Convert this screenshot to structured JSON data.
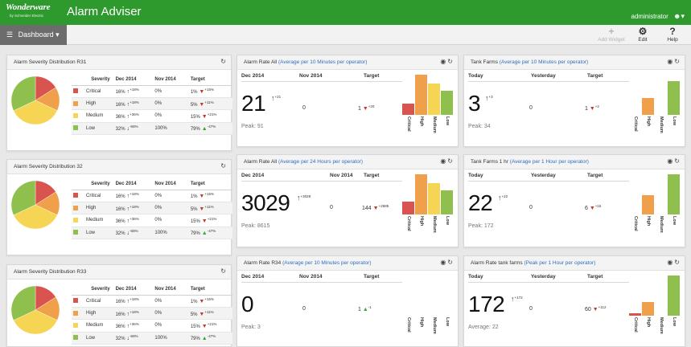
{
  "header": {
    "logo_text": "Wonderware",
    "logo_sub": "by Schneider Electric",
    "title": "Alarm Adviser",
    "user": "administrator"
  },
  "toolbar": {
    "dashboard_label": "Dashboard",
    "add_widget_label": "Add Widget",
    "edit_label": "Edit",
    "help_label": "Help"
  },
  "colors": {
    "critical": "#d9534f",
    "high": "#f0a04b",
    "medium": "#f7d554",
    "low": "#8fbf4d",
    "brand_green": "#2e9a2e"
  },
  "severity_panels": [
    {
      "title": "Alarm Severity Distribution R31",
      "headers": [
        "Severity",
        "Dec 2014",
        "Nov 2014",
        "Target"
      ],
      "rows": [
        {
          "sev": "Critical",
          "dec": "16%",
          "dec_delta": "+18%",
          "nov": "0%",
          "target": "1%",
          "target_delta": "+15%"
        },
        {
          "sev": "High",
          "dec": "16%",
          "dec_delta": "+18%",
          "nov": "0%",
          "target": "5%",
          "target_delta": "+11%"
        },
        {
          "sev": "Medium",
          "dec": "36%",
          "dec_delta": "+36%",
          "nov": "0%",
          "target": "15%",
          "target_delta": "+21%"
        },
        {
          "sev": "Low",
          "dec": "32%",
          "dec_delta": "-68%",
          "nov": "100%",
          "target": "79%",
          "target_delta": "-47%"
        }
      ]
    },
    {
      "title": "Alarm Severity Distribution 32",
      "headers": [
        "Severity",
        "Dec 2014",
        "Nov 2014",
        "Target"
      ],
      "rows": [
        {
          "sev": "Critical",
          "dec": "16%",
          "dec_delta": "+18%",
          "nov": "0%",
          "target": "1%",
          "target_delta": "+15%"
        },
        {
          "sev": "High",
          "dec": "16%",
          "dec_delta": "+18%",
          "nov": "0%",
          "target": "5%",
          "target_delta": "+11%"
        },
        {
          "sev": "Medium",
          "dec": "36%",
          "dec_delta": "+36%",
          "nov": "0%",
          "target": "15%",
          "target_delta": "+21%"
        },
        {
          "sev": "Low",
          "dec": "32%",
          "dec_delta": "-68%",
          "nov": "100%",
          "target": "79%",
          "target_delta": "-47%"
        }
      ]
    },
    {
      "title": "Alarm Severity Distribution R33",
      "headers": [
        "Severity",
        "Dec 2014",
        "Nov 2014",
        "Target"
      ],
      "rows": [
        {
          "sev": "Critical",
          "dec": "16%",
          "dec_delta": "+18%",
          "nov": "0%",
          "target": "1%",
          "target_delta": "+15%"
        },
        {
          "sev": "High",
          "dec": "16%",
          "dec_delta": "+18%",
          "nov": "0%",
          "target": "5%",
          "target_delta": "+11%"
        },
        {
          "sev": "Medium",
          "dec": "36%",
          "dec_delta": "+36%",
          "nov": "0%",
          "target": "15%",
          "target_delta": "+21%"
        },
        {
          "sev": "Low",
          "dec": "32%",
          "dec_delta": "-68%",
          "nov": "100%",
          "target": "79%",
          "target_delta": "-47%"
        }
      ]
    }
  ],
  "pie_shares": [
    {
      "sev": "Critical",
      "pct": 16
    },
    {
      "sev": "High",
      "pct": 16
    },
    {
      "sev": "Medium",
      "pct": 36
    },
    {
      "sev": "Low",
      "pct": 32
    }
  ],
  "rate_panels": [
    {
      "title": "Alarm Rate All",
      "subtitle": "(Average per 10 Minutes per operator)",
      "col1": "Dec 2014",
      "col2": "Nov 2014",
      "col3": "Target",
      "big": "21",
      "big_delta": "+21",
      "big_trend": "up",
      "mid": "0",
      "target": "1",
      "target_delta": "+20",
      "target_trend": "down",
      "peak": "Peak: 91",
      "bars": [
        {
          "sev": "Critical",
          "level": 0.27
        },
        {
          "sev": "High",
          "level": 1.0
        },
        {
          "sev": "Medium",
          "level": 0.77
        },
        {
          "sev": "Low",
          "level": 0.6
        }
      ]
    },
    {
      "title": "Tank Farms",
      "subtitle": "(Average per 10 Minutes per operator)",
      "col1": "Today",
      "col2": "Yesterday",
      "col3": "Target",
      "big": "3",
      "big_delta": "+3",
      "big_trend": "up",
      "mid": "0",
      "target": "1",
      "target_delta": "+2",
      "target_trend": "down",
      "peak": "Peak: 34",
      "bars": [
        {
          "sev": "Critical",
          "level": 0
        },
        {
          "sev": "High",
          "level": 0.42
        },
        {
          "sev": "Medium",
          "level": 0
        },
        {
          "sev": "Low",
          "level": 0.83
        }
      ]
    },
    {
      "title": "Alarm Rate All",
      "subtitle": "(Average per 24 Hours per operator)",
      "col1": "Dec 2014",
      "col2": "Nov 2014",
      "col3": "Target",
      "big": "3029",
      "big_delta": "+3029",
      "big_trend": "up",
      "mid": "0",
      "target": "144",
      "target_delta": "+2885",
      "target_trend": "down",
      "peak": "Peak: 8615",
      "bars": [
        {
          "sev": "Critical",
          "level": 0.32
        },
        {
          "sev": "High",
          "level": 1.0
        },
        {
          "sev": "Medium",
          "level": 0.77
        },
        {
          "sev": "Low",
          "level": 0.6
        }
      ]
    },
    {
      "title": "Tank Farms 1 hr",
      "subtitle": "(Average per 1 Hour per operator)",
      "col1": "Today",
      "col2": "Yesterday",
      "col3": "Target",
      "big": "22",
      "big_delta": "+22",
      "big_trend": "up",
      "mid": "0",
      "target": "6",
      "target_delta": "+16",
      "target_trend": "down",
      "peak": "Peak: 172",
      "bars": [
        {
          "sev": "Critical",
          "level": 0
        },
        {
          "sev": "High",
          "level": 0.47
        },
        {
          "sev": "Medium",
          "level": 0
        },
        {
          "sev": "Low",
          "level": 1.0
        }
      ]
    },
    {
      "title": "Alarm Rate R34",
      "subtitle": "(Average per 10 Minutes per operator)",
      "col1": "Dec 2014",
      "col2": "Nov 2014",
      "col3": "Target",
      "big": "0",
      "big_delta": "",
      "big_trend": "none",
      "mid": "0",
      "target": "1",
      "target_delta": "-1",
      "target_trend": "up",
      "peak": "Peak: 3",
      "bars": [
        {
          "sev": "Critical",
          "level": 0
        },
        {
          "sev": "High",
          "level": 0
        },
        {
          "sev": "Medium",
          "level": 0
        },
        {
          "sev": "Low",
          "level": 0
        }
      ]
    },
    {
      "title": "Alarm Rate tank farms",
      "subtitle": "(Peak per 1 Hour per operator)",
      "col1": "Today",
      "col2": "Yesterday",
      "col3": "Target",
      "big": "172",
      "big_delta": "+172",
      "big_trend": "up",
      "mid": "0",
      "target": "60",
      "target_delta": "+112",
      "target_trend": "down",
      "peak": "Average: 22",
      "bars": [
        {
          "sev": "Critical",
          "level": 0.06
        },
        {
          "sev": "High",
          "level": 0.34
        },
        {
          "sev": "Medium",
          "level": 0
        },
        {
          "sev": "Low",
          "level": 1.0
        }
      ]
    }
  ]
}
